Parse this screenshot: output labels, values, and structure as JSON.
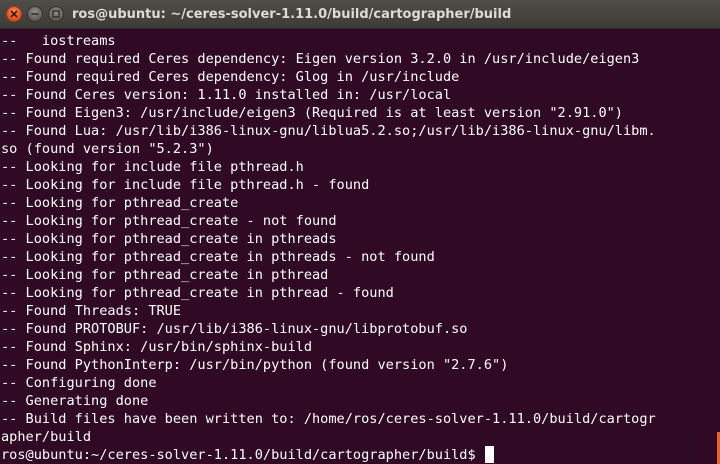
{
  "window": {
    "title": "ros@ubuntu: ~/ceres-solver-1.11.0/build/cartographer/build"
  },
  "terminal": {
    "lines": [
      "--   iostreams",
      "-- Found required Ceres dependency: Eigen version 3.2.0 in /usr/include/eigen3",
      "-- Found required Ceres dependency: Glog in /usr/include",
      "-- Found Ceres version: 1.11.0 installed in: /usr/local",
      "-- Found Eigen3: /usr/include/eigen3 (Required is at least version \"2.91.0\")",
      "-- Found Lua: /usr/lib/i386-linux-gnu/liblua5.2.so;/usr/lib/i386-linux-gnu/libm.",
      "so (found version \"5.2.3\")",
      "-- Looking for include file pthread.h",
      "-- Looking for include file pthread.h - found",
      "-- Looking for pthread_create",
      "-- Looking for pthread_create - not found",
      "-- Looking for pthread_create in pthreads",
      "-- Looking for pthread_create in pthreads - not found",
      "-- Looking for pthread_create in pthread",
      "-- Looking for pthread_create in pthread - found",
      "-- Found Threads: TRUE",
      "-- Found PROTOBUF: /usr/lib/i386-linux-gnu/libprotobuf.so",
      "-- Found Sphinx: /usr/bin/sphinx-build",
      "-- Found PythonInterp: /usr/bin/python (found version \"2.7.6\")",
      "-- Configuring done",
      "-- Generating done",
      "-- Build files have been written to: /home/ros/ceres-solver-1.11.0/build/cartogr",
      "apher/build"
    ],
    "prompt": "ros@ubuntu:~/ceres-solver-1.11.0/build/cartographer/build$ "
  },
  "colors": {
    "background": "#300a24",
    "text": "#ffffff",
    "titlebar": "#3c3b37",
    "close_button": "#e2531d",
    "scroll_indicator": "#e8632c"
  }
}
